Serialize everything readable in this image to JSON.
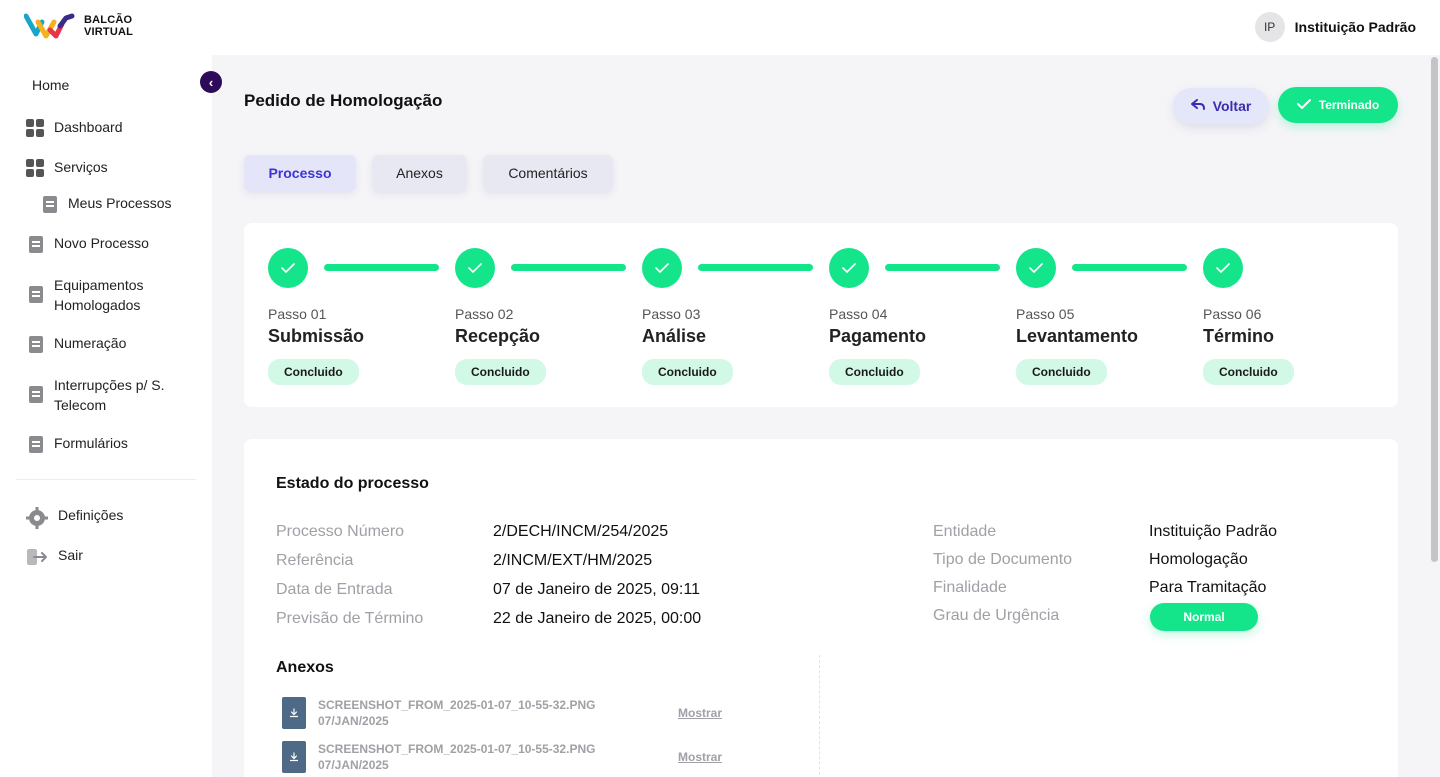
{
  "header": {
    "logo_line1": "BALCÃO",
    "logo_line2": "VIRTUAL",
    "avatar_initials": "IP",
    "user_name": "Instituição Padrão"
  },
  "sidebar": {
    "collapse_glyph": "‹",
    "items": [
      {
        "label": "Home",
        "icon": ""
      },
      {
        "label": "Dashboard",
        "icon": "grid-icon"
      },
      {
        "label": "Serviços",
        "icon": "grid-icon"
      },
      {
        "label": "Meus Processos",
        "icon": "document-icon"
      },
      {
        "label": "Novo Processo",
        "icon": "document-icon"
      },
      {
        "label": "Equipamentos Homologados",
        "icon": "document-icon"
      },
      {
        "label": "Numeração",
        "icon": "document-icon"
      },
      {
        "label": "Interrupções p/ S. Telecom",
        "icon": "document-icon"
      },
      {
        "label": "Formulários",
        "icon": "document-icon"
      },
      {
        "label": "Definições",
        "icon": "gear-icon"
      },
      {
        "label": "Sair",
        "icon": "logout-icon"
      }
    ]
  },
  "main": {
    "title": "Pedido de Homologação",
    "back_label": "Voltar",
    "status_label": "Terminado",
    "tabs": [
      "Processo",
      "Anexos",
      "Comentários"
    ],
    "steps": [
      {
        "num": "Passo 01",
        "name": "Submissão",
        "status": "Concluido"
      },
      {
        "num": "Passo 02",
        "name": "Recepção",
        "status": "Concluido"
      },
      {
        "num": "Passo 03",
        "name": "Análise",
        "status": "Concluido"
      },
      {
        "num": "Passo 04",
        "name": "Pagamento",
        "status": "Concluido"
      },
      {
        "num": "Passo 05",
        "name": "Levantamento",
        "status": "Concluido"
      },
      {
        "num": "Passo 06",
        "name": "Término",
        "status": "Concluido"
      }
    ],
    "estado": {
      "title": "Estado do processo",
      "left": [
        {
          "label": "Processo Número",
          "value": "2/DECH/INCM/254/2025"
        },
        {
          "label": "Referência",
          "value": "2/INCM/EXT/HM/2025"
        },
        {
          "label": "Data de Entrada",
          "value": "07 de Janeiro de 2025, 09:11"
        },
        {
          "label": "Previsão de Término",
          "value": "22 de Janeiro de 2025, 00:00"
        }
      ],
      "right": [
        {
          "label": "Entidade",
          "value": "Instituição Padrão"
        },
        {
          "label": "Tipo de Documento",
          "value": "Homologação"
        },
        {
          "label": "Finalidade",
          "value": "Para Tramitação"
        },
        {
          "label": "Grau de Urgência",
          "value": "Normal"
        }
      ]
    },
    "anexos": {
      "title": "Anexos",
      "files": [
        {
          "name": "SCREENSHOT_FROM_2025-01-07_10-55-32.PNG",
          "date": "07/JAN/2025",
          "action": "Mostrar"
        },
        {
          "name": "SCREENSHOT_FROM_2025-01-07_10-55-32.PNG",
          "date": "07/JAN/2025",
          "action": "Mostrar"
        }
      ]
    }
  },
  "colors": {
    "accent_green": "#14e58a",
    "accent_purple": "#3b35d6",
    "dark_purple": "#2d0b5a"
  }
}
